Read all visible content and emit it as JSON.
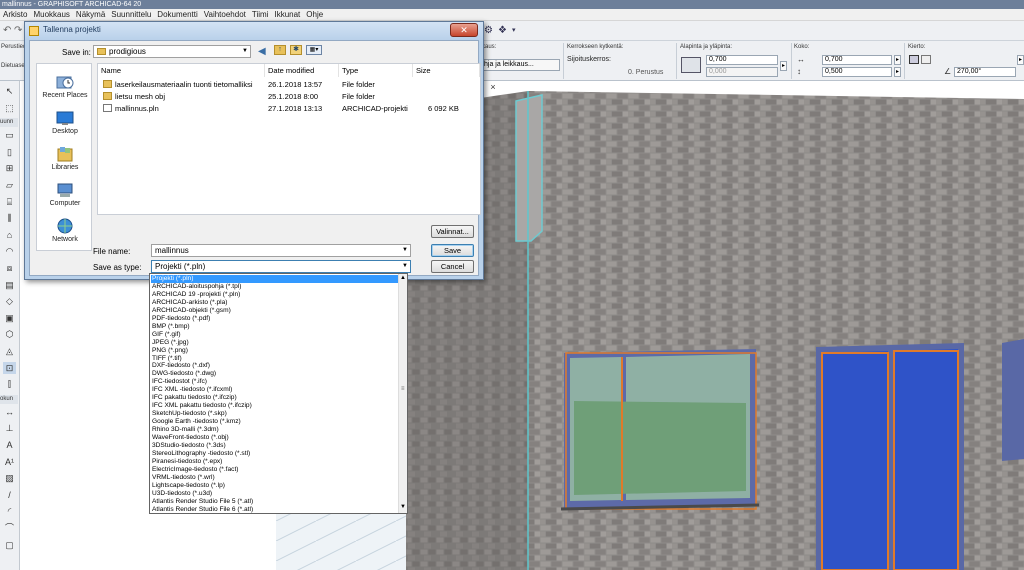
{
  "app": {
    "title": "mallinnus - GRAPHISOFT ARCHICAD-64 20",
    "menu": [
      "Arkisto",
      "Muokkaus",
      "Näkymä",
      "Suunnittelu",
      "Dokumentti",
      "Vaihtoehdot",
      "Tiimi",
      "Ikkunat",
      "Ohje"
    ]
  },
  "infobox": {
    "left_label_1": "Perustiedot",
    "left_label_2": "Dietuaset",
    "view_label": "kaus:",
    "view_button": "hja ja leikkaus...",
    "floor_header": "Kerrokseen kytkentä:",
    "floor_text": "Sijoituskerros:",
    "floor_value": "0. Perustus",
    "sill_header": "Alapinta ja yläpinta:",
    "sill_top": "0,700",
    "sill_bottom": "0,000",
    "size_header": "Koko:",
    "width_value": "0,700",
    "height_value": "0,500",
    "rotation_header": "Kierto:",
    "angle_value": "270,00°"
  },
  "toolbox": {
    "label_1": "uunn",
    "label_2": "okun",
    "icons": [
      "arrow-icon",
      "marquee-icon",
      "wall-icon",
      "column-icon",
      "beam-icon",
      "slab-icon",
      "stair-icon",
      "railing-icon",
      "roof-icon",
      "shell-icon",
      "skylight-icon",
      "curtain-wall-icon",
      "morph-icon",
      "object-icon",
      "zone-icon",
      "mesh-icon",
      "window-icon",
      "door-icon",
      "dimension-icon",
      "level-icon",
      "text-icon",
      "label-icon",
      "fill-icon",
      "line-icon",
      "arc-icon",
      "polyline-icon",
      "drawing-icon"
    ]
  },
  "view": {
    "tab_close": "×"
  },
  "dialog": {
    "title": "Tallenna projekti",
    "close": "✕",
    "save_in_label": "Save in:",
    "save_in_value": "prodigious",
    "nav_icons": [
      "back-icon",
      "up-folder-icon",
      "new-folder-icon",
      "view-menu-icon"
    ],
    "places": [
      "Recent Places",
      "Desktop",
      "Libraries",
      "Computer",
      "Network"
    ],
    "columns": [
      "Name",
      "Date modified",
      "Type",
      "Size"
    ],
    "files": [
      {
        "name": "laserkeilausmateriaalin tuonti tietomalliksi",
        "date": "26.1.2018 13:57",
        "type": "File folder",
        "size": "",
        "icon": "folder-icon"
      },
      {
        "name": "lietsu mesh obj",
        "date": "25.1.2018 8:00",
        "type": "File folder",
        "size": "",
        "icon": "folder-icon"
      },
      {
        "name": "mallinnus.pln",
        "date": "27.1.2018 13:13",
        "type": "ARCHICAD-projekti",
        "size": "6 092 KB",
        "icon": "pln-file-icon"
      }
    ],
    "options_button": "Valinnat...",
    "filename_label": "File name:",
    "filename_value": "mallinnus",
    "savetype_label": "Save as type:",
    "savetype_value": "Projekti (*.pln)",
    "save_button": "Save",
    "cancel_button": "Cancel"
  },
  "filetypes": [
    "Projekti (*.pln)",
    "ARCHICAD-aloituspohja (*.tpl)",
    "ARCHICAD 19 -projekti (*.pln)",
    "ARCHICAD-arkisto (*.pla)",
    "ARCHICAD-objekti (*.gsm)",
    "PDF-tiedosto (*.pdf)",
    "BMP (*.bmp)",
    "GIF (*.gif)",
    "JPEG (*.jpg)",
    "PNG (*.png)",
    "TIFF (*.tif)",
    "DXF-tiedosto (*.dxf)",
    "DWG-tiedosto (*.dwg)",
    "IFC-tiedostot (*.ifc)",
    "IFC XML -tiedosto (*.ifcxml)",
    "IFC pakattu tiedosto (*.ifczip)",
    "IFC XML pakattu tiedosto (*.ifczip)",
    "SketchUp-tiedosto (*.skp)",
    "Google Earth -tiedosto (*.kmz)",
    "Rhino 3D-malli (*.3dm)",
    "WaveFront-tiedosto (*.obj)",
    "3DStudio-tiedosto (*.3ds)",
    "StereoLithography -tiedosto (*.stl)",
    "Piranesi-tiedosto (*.epx)",
    "ElectricImage-tiedosto (*.fact)",
    "VRML-tiedosto (*.wrl)",
    "Lightscape-tiedosto (*.lp)",
    "U3D-tiedosto (*.u3d)",
    "Atlantis Render Studio File 5 (*.atl)",
    "Atlantis Render Studio File 6 (*.atl)"
  ],
  "colors": {
    "accent": "#3399ff",
    "wall": "#8d8a88",
    "frame": "#3c4fb0",
    "door_orange": "#e07a2a"
  }
}
